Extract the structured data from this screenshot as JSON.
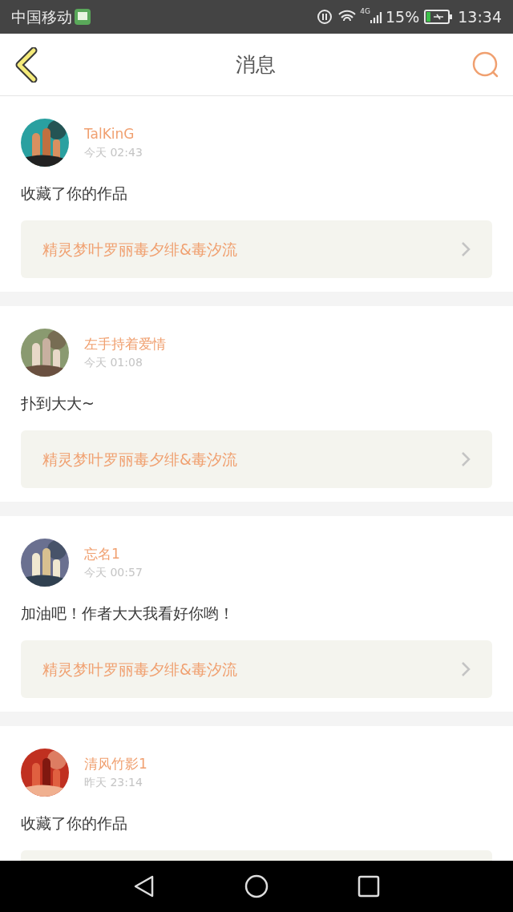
{
  "status_bar": {
    "carrier": "中国移动",
    "network": "4G",
    "battery": "15%",
    "time": "13:34"
  },
  "header": {
    "title": "消息"
  },
  "messages": [
    {
      "name": "TalKinG",
      "time": "今天 02:43",
      "text": "收藏了你的作品",
      "link": "精灵梦叶罗丽毒夕绯&毒汐流"
    },
    {
      "name": "左手持着爱情",
      "time": "今天 01:08",
      "text": "扑到大大~",
      "link": "精灵梦叶罗丽毒夕绯&毒汐流"
    },
    {
      "name": "忘名1",
      "time": "今天 00:57",
      "text": "加油吧！作者大大我看好你哟！",
      "link": "精灵梦叶罗丽毒夕绯&毒汐流"
    },
    {
      "name": "清风竹影1",
      "time": "昨天 23:14",
      "text": "收藏了你的作品"
    }
  ]
}
